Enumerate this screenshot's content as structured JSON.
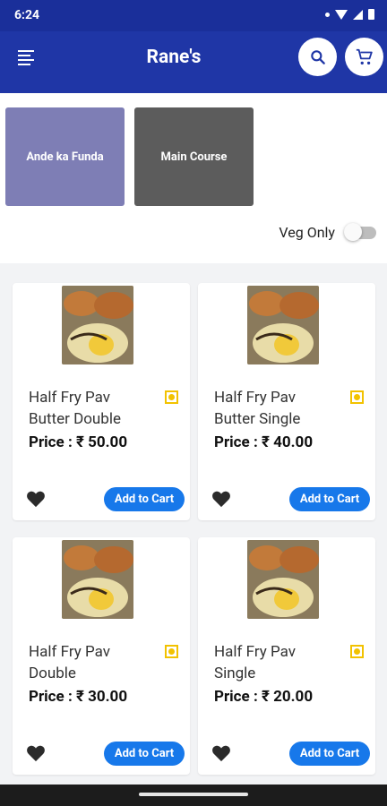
{
  "status_bar": {
    "time": "6:24"
  },
  "app_bar": {
    "title": "Rane's"
  },
  "categories": [
    {
      "label": "Ande ka Funda",
      "color": "#7e7eb5"
    },
    {
      "label": "Main Course",
      "color": "#5c5c5c"
    }
  ],
  "filter": {
    "veg_only_label": "Veg Only",
    "veg_only_on": false
  },
  "products": [
    {
      "name": "Half Fry Pav Butter Double",
      "price": "Price : ₹ 50.00",
      "add_label": "Add to Cart"
    },
    {
      "name": "Half Fry Pav Butter Single",
      "price": "Price : ₹ 40.00",
      "add_label": "Add to Cart"
    },
    {
      "name": "Half Fry Pav Double",
      "price": "Price : ₹ 30.00",
      "add_label": "Add to Cart"
    },
    {
      "name": "Half Fry Pav Single",
      "price": "Price : ₹ 20.00",
      "add_label": "Add to Cart"
    }
  ],
  "theme": {
    "primary": "#1f36a6",
    "accent": "#1778ea",
    "veg_indicator": "#f2c200"
  }
}
